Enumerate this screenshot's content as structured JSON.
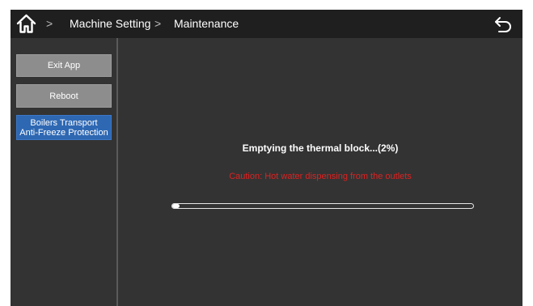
{
  "header": {
    "home_icon": "home-icon",
    "separator_icon": "chevron-right",
    "breadcrumb": [
      "Machine Setting",
      "Maintenance"
    ],
    "back_icon": "back-arrow-icon"
  },
  "sidebar": {
    "items": [
      {
        "label": "Exit App",
        "active": false
      },
      {
        "label": "Reboot",
        "active": false
      },
      {
        "label_lines": [
          "Boilers Transport",
          "Anti-Freeze Protection"
        ],
        "active": true
      }
    ]
  },
  "main": {
    "status": "Emptying the thermal block...(2%)",
    "caution": "Caution: Hot water dispensing from the outlets",
    "progress_percent": 2
  },
  "colors": {
    "header_bg": "#1f1f1f",
    "content_bg": "#333333",
    "button_bg": "#8d8d8d",
    "active_button_bg": "#2e68b3",
    "caution": "#e02020"
  }
}
